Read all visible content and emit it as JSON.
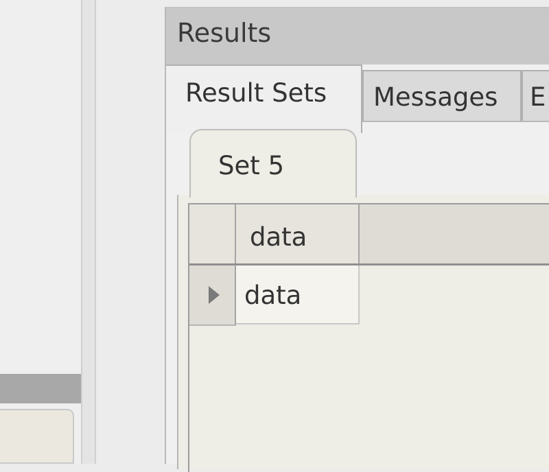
{
  "results": {
    "title": "Results",
    "tabs": [
      {
        "label": "Result Sets",
        "selected": true
      },
      {
        "label": "Messages",
        "selected": false
      },
      {
        "label": "E",
        "selected": false
      }
    ],
    "set_tab": {
      "label": "Set 5"
    },
    "grid": {
      "columns": [
        "data"
      ],
      "rows": [
        [
          "data"
        ]
      ]
    }
  },
  "icons": {
    "row_indicator": "triangle-right-icon"
  }
}
